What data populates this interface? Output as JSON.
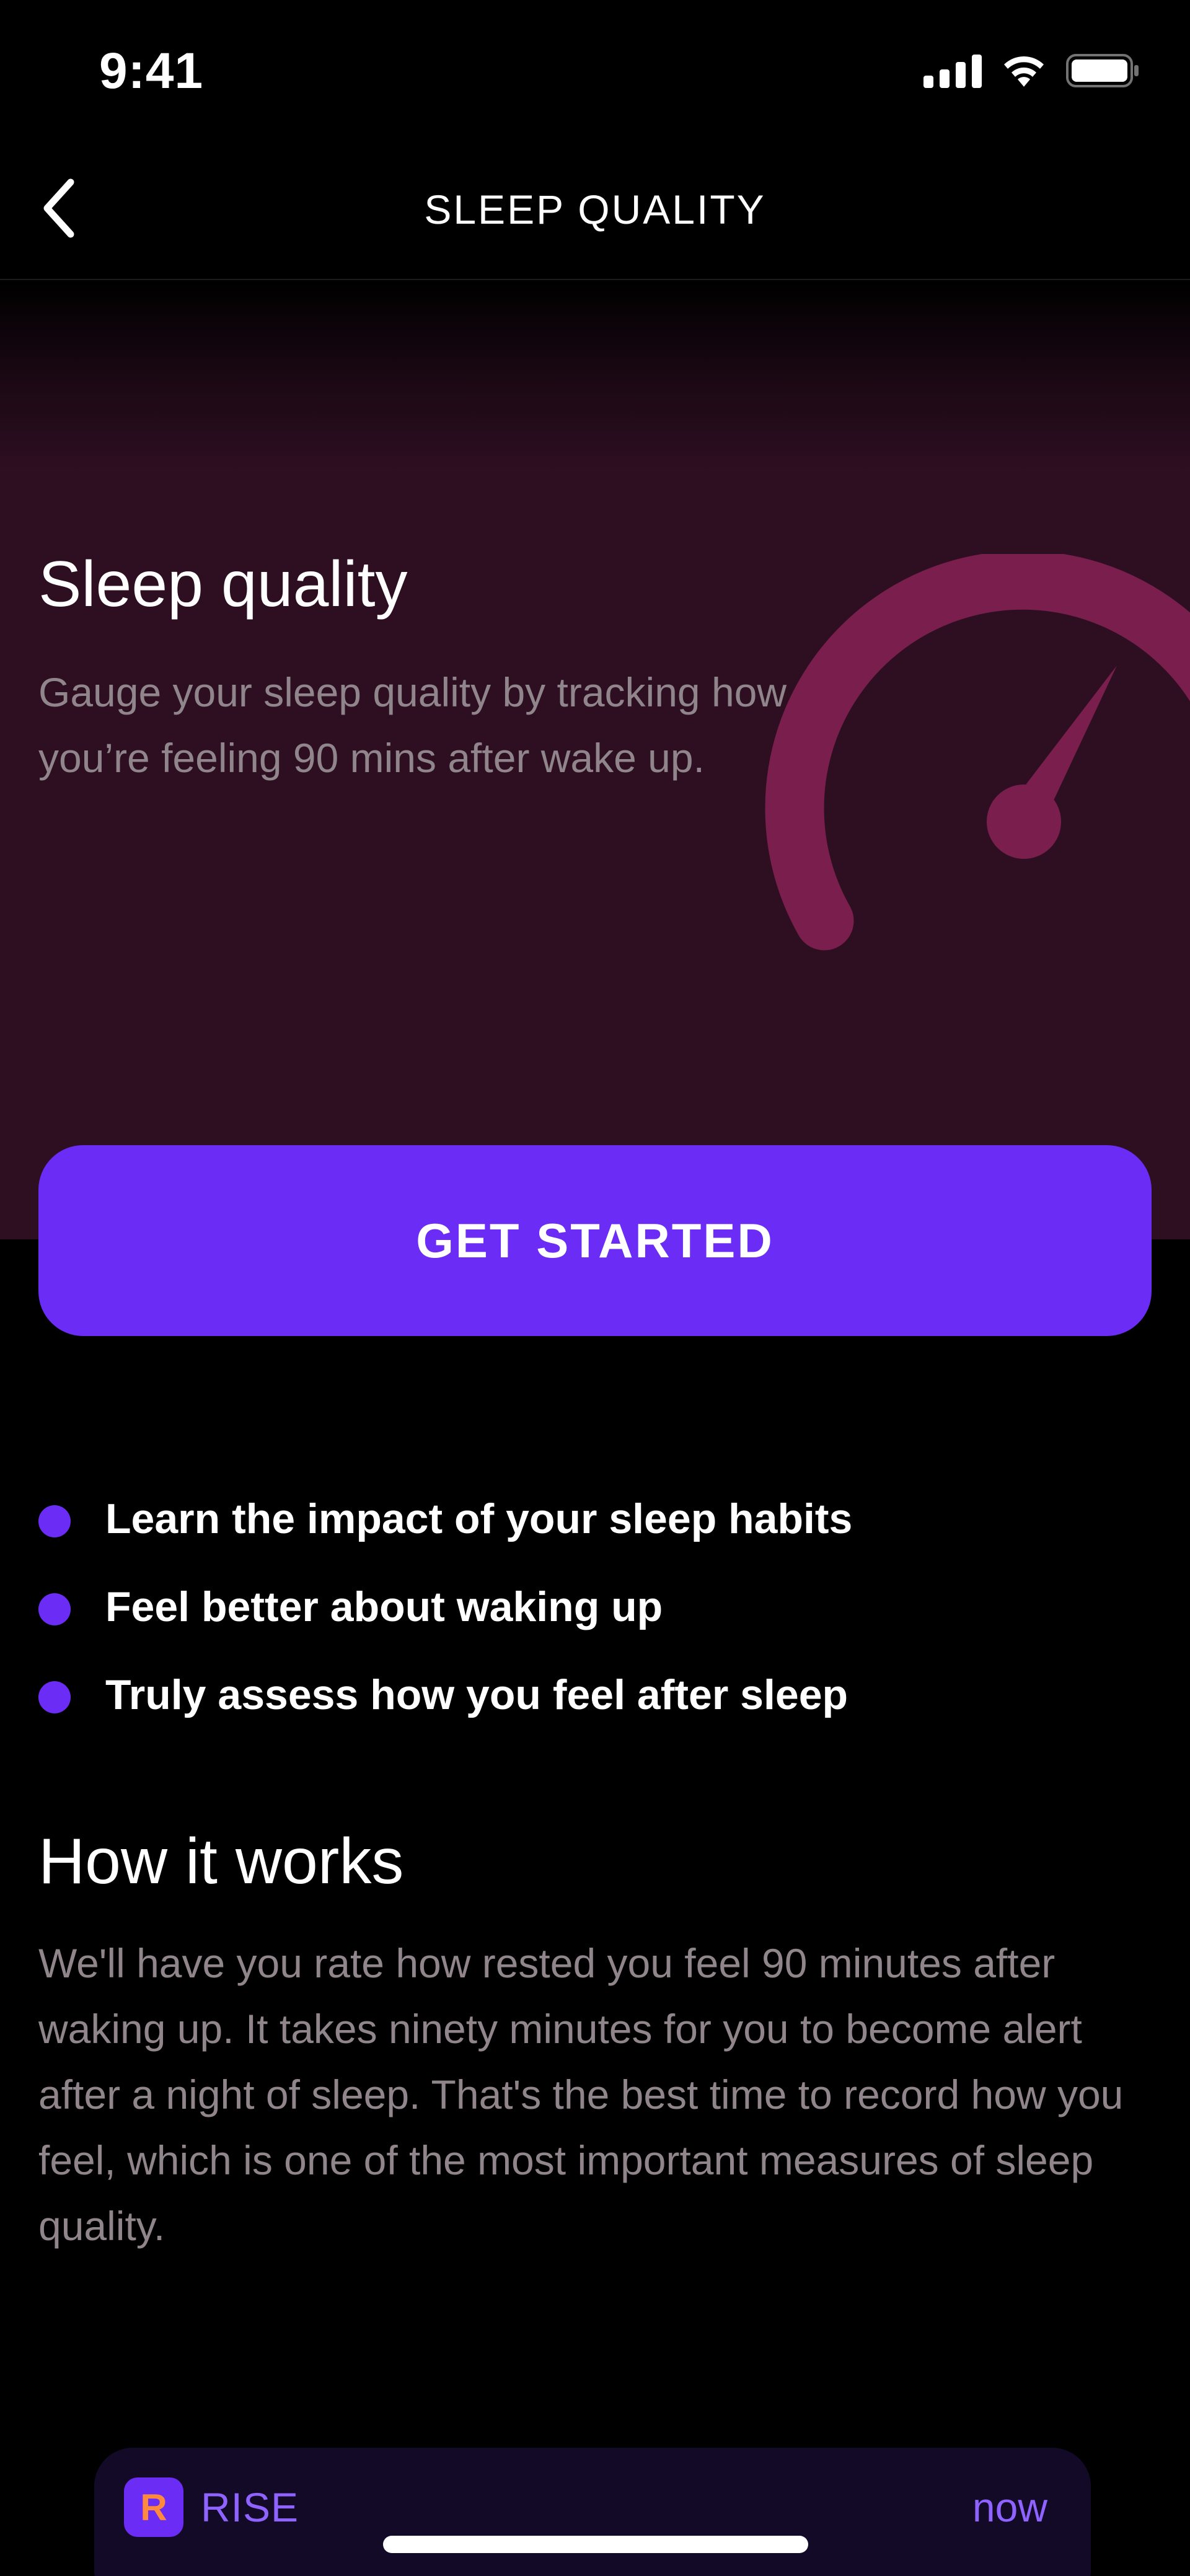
{
  "status_bar": {
    "time": "9:41"
  },
  "nav": {
    "title": "SLEEP QUALITY",
    "back_icon": "chevron-left-icon"
  },
  "hero": {
    "title": "Sleep quality",
    "description": "Gauge your sleep quality by tracking how you’re feeling 90 mins after wake up.",
    "icon": "gauge-icon"
  },
  "cta": {
    "label": "GET STARTED"
  },
  "benefits": [
    "Learn the impact of your sleep habits",
    "Feel better about waking up",
    "Truly assess how you feel after sleep"
  ],
  "how_it_works": {
    "title": "How it works",
    "body": "We'll have you rate how rested you feel 90 minutes after waking up. It takes ninety minutes for you to become alert after a night of sleep. That's the best time to record how you feel, which is one of the most important measures of sleep quality."
  },
  "notification": {
    "app_icon_letter": "R",
    "app_name": "RISE",
    "time": "now"
  },
  "colors": {
    "accent": "#6b2cf5",
    "hero_bg": "#2e0f22",
    "gauge": "#7a1f4d",
    "muted_text": "#8f858b",
    "notification_text": "#8f63ff"
  }
}
